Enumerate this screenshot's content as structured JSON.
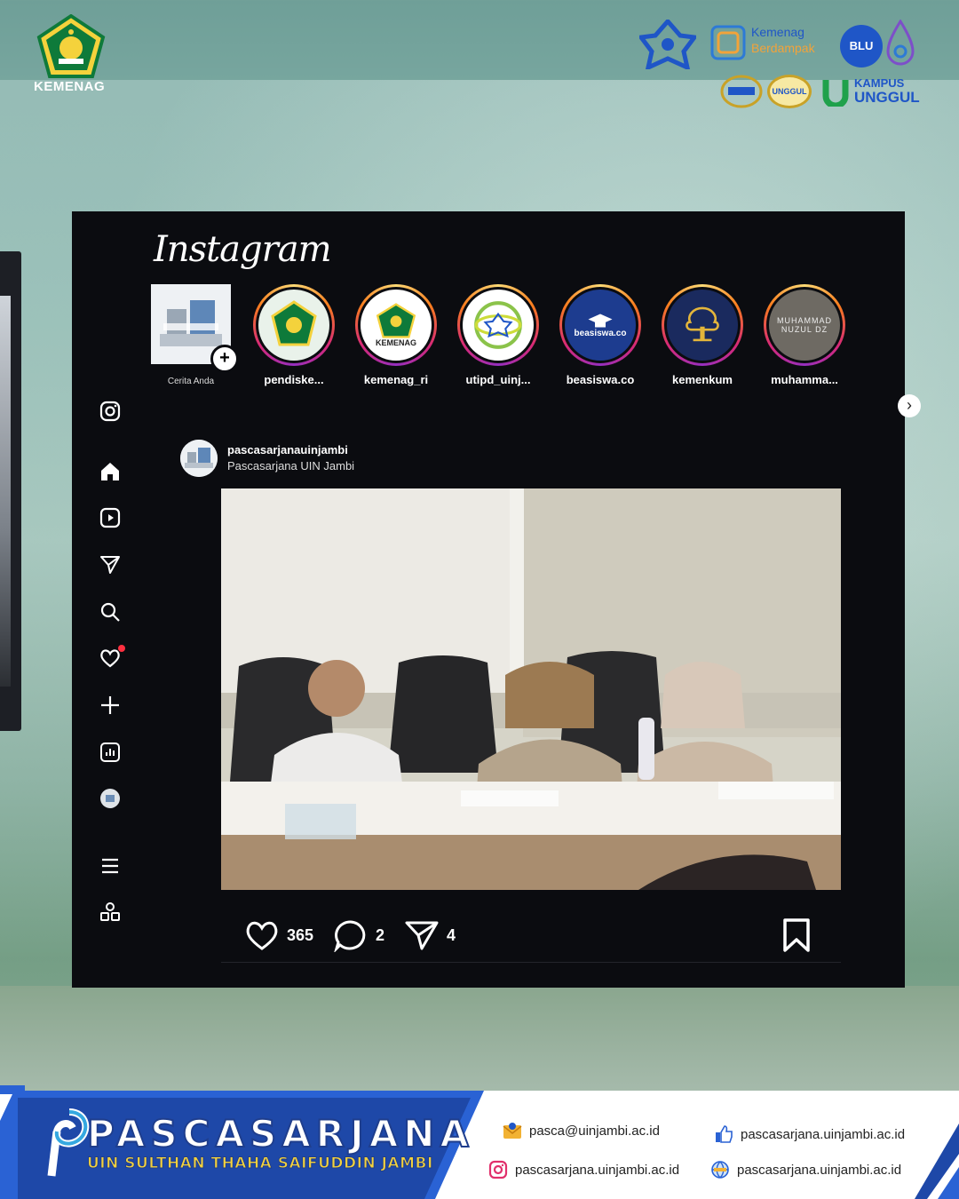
{
  "header": {
    "org_name": "KEMENAG",
    "partner_logos": [
      {
        "name": "uin-jambi-logo"
      },
      {
        "name": "kemenag-berdampak-logo",
        "line1": "Kemenag",
        "line2": "Berdampak"
      },
      {
        "name": "blu-logo",
        "text": "BLU"
      },
      {
        "name": "accreditation-unggul-badge-1"
      },
      {
        "name": "accreditation-unggul-badge-2",
        "text": "UNGGUL"
      },
      {
        "name": "kampus-unggul-logo",
        "line1": "KAMPUS",
        "line2": "UNGGUL"
      }
    ]
  },
  "instagram": {
    "logo_text": "Instagram",
    "stories": [
      {
        "label": "Cerita Anda",
        "own": true
      },
      {
        "label": "pendiske...",
        "icon": "kemenag-emblem-icon"
      },
      {
        "label": "kemenag_ri",
        "icon": "kemenag-emblem-icon",
        "badge": "KEMENAG"
      },
      {
        "label": "utipd_uinj...",
        "icon": "utipd-logo-icon"
      },
      {
        "label": "beasiswa.co",
        "icon": "graduation-cap-icon",
        "badge": "beasiswa.co"
      },
      {
        "label": "kemenkum",
        "icon": "pengayoman-tree-icon"
      },
      {
        "label": "muhamma...",
        "badge": "MUHAMMAD NUZUL DZ"
      }
    ],
    "sidebar": [
      {
        "name": "instagram-icon"
      },
      {
        "name": "home-icon"
      },
      {
        "name": "reels-icon"
      },
      {
        "name": "send-icon"
      },
      {
        "name": "search-icon"
      },
      {
        "name": "heart-icon",
        "has_notification": true
      },
      {
        "name": "plus-icon"
      },
      {
        "name": "insights-icon"
      },
      {
        "name": "profile-avatar-icon"
      },
      {
        "name": "menu-icon"
      },
      {
        "name": "apps-icon"
      }
    ],
    "post": {
      "username": "pascasarjanauinjambi",
      "subtitle": "Pascasarjana UIN Jambi",
      "likes": "365",
      "comments": "2",
      "shares": "4"
    }
  },
  "footer": {
    "brand_title": "PASCASARJANA",
    "brand_subtitle": "UIN SULTHAN THAHA SAIFUDDIN JAMBI",
    "email": "pasca@uinjambi.ac.id",
    "facebook": "pascasarjana.uinjambi.ac.id",
    "instagram": "pascasarjana.uinjambi.ac.id",
    "website": "pascasarjana.uinjambi.ac.id"
  },
  "colors": {
    "card_bg": "#0b0c10",
    "footer_blue": "#1f56c7",
    "kemenag_green": "#0e7a3a",
    "kemenag_gold": "#f4d23c"
  }
}
